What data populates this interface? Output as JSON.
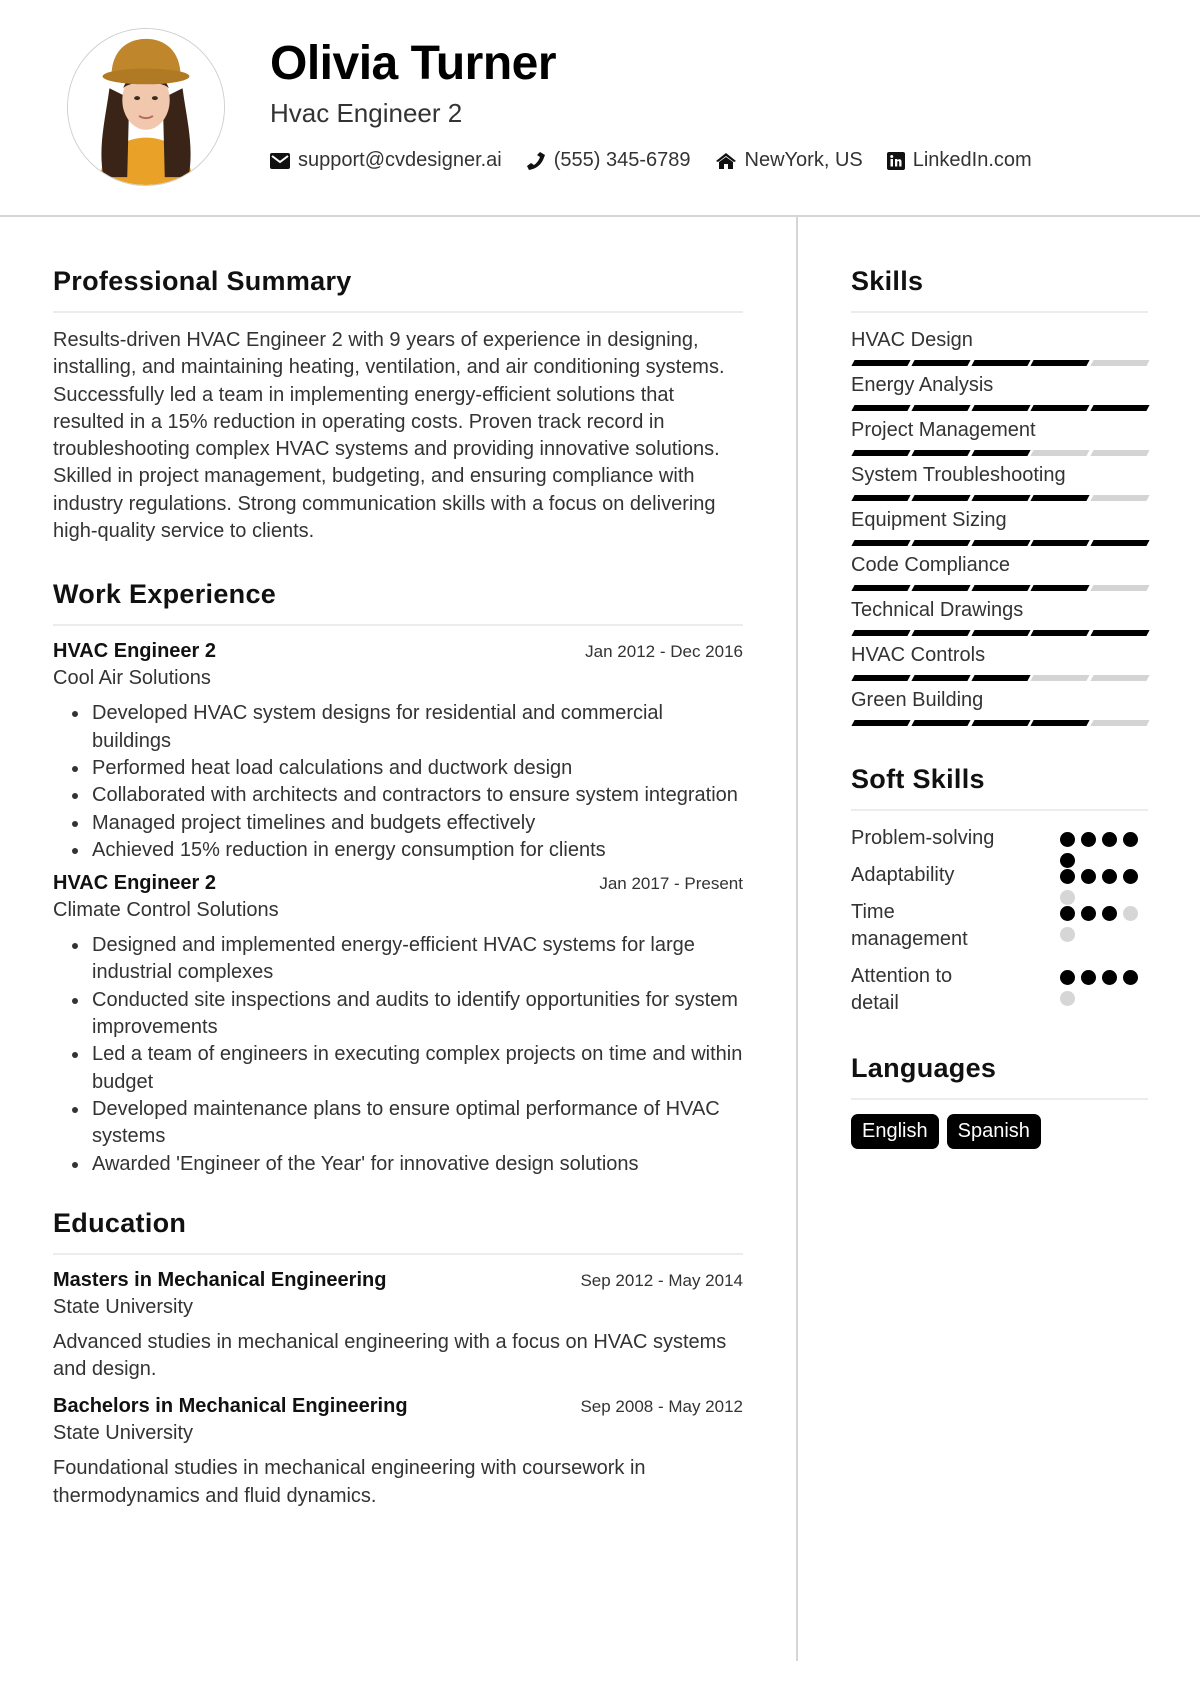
{
  "header": {
    "name": "Olivia Turner",
    "title": "Hvac Engineer 2",
    "contacts": [
      {
        "icon": "envelope-icon",
        "text": "support@cvdesigner.ai"
      },
      {
        "icon": "phone-icon",
        "text": "(555) 345-6789"
      },
      {
        "icon": "home-icon",
        "text": "NewYork, US"
      },
      {
        "icon": "linkedin-icon",
        "text": "LinkedIn.com"
      }
    ]
  },
  "summary": {
    "heading": "Professional Summary",
    "text": "Results-driven HVAC Engineer 2 with 9 years of experience in designing, installing, and maintaining heating, ventilation, and air conditioning systems. Successfully led a team in implementing energy-efficient solutions that resulted in a 15% reduction in operating costs. Proven track record in troubleshooting complex HVAC systems and providing innovative solutions. Skilled in project management, budgeting, and ensuring compliance with industry regulations. Strong communication skills with a focus on delivering high-quality service to clients."
  },
  "experience": {
    "heading": "Work Experience",
    "jobs": [
      {
        "title": "HVAC Engineer 2",
        "dates": "Jan 2012 - Dec 2016",
        "company": "Cool Air Solutions",
        "bullets": [
          "Developed HVAC system designs for residential and commercial buildings",
          "Performed heat load calculations and ductwork design",
          "Collaborated with architects and contractors to ensure system integration",
          "Managed project timelines and budgets effectively",
          "Achieved 15% reduction in energy consumption for clients"
        ]
      },
      {
        "title": "HVAC Engineer 2",
        "dates": "Jan 2017 - Present",
        "company": "Climate Control Solutions",
        "bullets": [
          "Designed and implemented energy-efficient HVAC systems for large industrial complexes",
          "Conducted site inspections and audits to identify opportunities for system improvements",
          "Led a team of engineers in executing complex projects on time and within budget",
          "Developed maintenance plans to ensure optimal performance of HVAC systems",
          "Awarded 'Engineer of the Year' for innovative design solutions"
        ]
      }
    ]
  },
  "education": {
    "heading": "Education",
    "items": [
      {
        "degree": "Masters in Mechanical Engineering",
        "dates": "Sep 2012 - May 2014",
        "school": "State University",
        "description": "Advanced studies in mechanical engineering with a focus on HVAC systems and design."
      },
      {
        "degree": "Bachelors in Mechanical Engineering",
        "dates": "Sep 2008 - May 2012",
        "school": "State University",
        "description": "Foundational studies in mechanical engineering with coursework in thermodynamics and fluid dynamics."
      }
    ]
  },
  "skills": {
    "heading": "Skills",
    "max": 5,
    "items": [
      {
        "label": "HVAC Design",
        "level": 4
      },
      {
        "label": "Energy Analysis",
        "level": 5
      },
      {
        "label": "Project Management",
        "level": 3
      },
      {
        "label": "System Troubleshooting",
        "level": 4
      },
      {
        "label": "Equipment Sizing",
        "level": 5
      },
      {
        "label": "Code Compliance",
        "level": 4
      },
      {
        "label": "Technical Drawings",
        "level": 5
      },
      {
        "label": "HVAC Controls",
        "level": 3
      },
      {
        "label": "Green Building",
        "level": 4
      }
    ]
  },
  "soft_skills": {
    "heading": "Soft Skills",
    "max": 5,
    "items": [
      {
        "label": "Problem-solving",
        "level": 5
      },
      {
        "label": "Adaptability",
        "level": 4
      },
      {
        "label": "Time management",
        "level": 3
      },
      {
        "label": "Attention to detail",
        "level": 4
      }
    ]
  },
  "languages": {
    "heading": "Languages",
    "items": [
      "English",
      "Spanish"
    ]
  },
  "colors": {
    "accent": "#000000",
    "inactive": "#d4d4d4",
    "divider": "#d6d6d6"
  }
}
